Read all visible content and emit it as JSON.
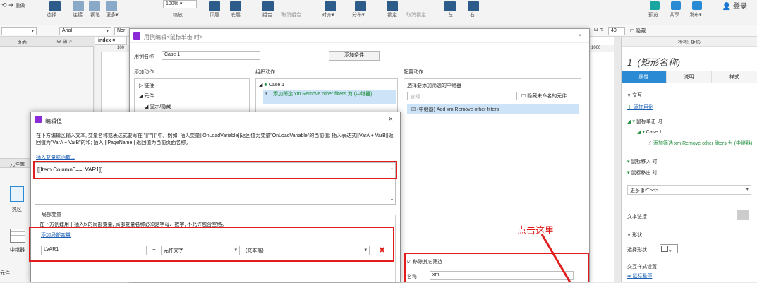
{
  "colors": {
    "accent": "#e11d1d",
    "purple": "#8b2bd8",
    "link": "#1a5fb4",
    "green": "#1e8c3a",
    "toolbar_blue": "#2d5b8a",
    "axure_blue": "#2a8bd4"
  },
  "toolbar": {
    "redo": "重做",
    "select": "选择",
    "connect": "连接",
    "pen": "钢笔",
    "more": "更多▾",
    "zoom_value": "100%",
    "zoom_label": "缩放",
    "top": "顶层",
    "bottom": "底层",
    "group": "组合",
    "ungroup": "取消组合",
    "align": "对齐▾",
    "distribute": "分布▾",
    "lock": "锁定",
    "unlock": "取消锁定",
    "left": "左",
    "right": "右",
    "preview": "预览",
    "share": "共享",
    "publish": "发布▾",
    "login": "登录"
  },
  "fontbar": {
    "font": "Arial",
    "style_hint": "Nor",
    "height_label": "h:",
    "height_value": "40",
    "hidden_label": "隐藏"
  },
  "left_panel": {
    "pages_title": "页面",
    "widgets_title": "元件库",
    "hotspot": "热区",
    "repeater": "中继器",
    "widget_footer": "元件"
  },
  "canvas": {
    "tab": "index",
    "ruler_100": "100",
    "ruler_1000": "1000"
  },
  "right_panel": {
    "title": "检视: 矩形",
    "shape_name": "(矩形名称)",
    "shape_index": "1",
    "tabs": [
      "属性",
      "说明",
      "样式"
    ],
    "interaction": "交互",
    "add_case": "添加用例",
    "on_click": "鼠标单击 时",
    "case1": "Case 1",
    "add_filter_action": "添加筛选 xm Remove other filters 为 (中继器)",
    "on_mouse_enter": "鼠标移入 时",
    "on_mouse_leave": "鼠标移出 时",
    "more_events": "更多事件>>>",
    "text_link": "文本链接",
    "shape_section": "形状",
    "select_shape": "选择形状",
    "interaction_style": "交互样式设置",
    "mouse_hover": "鼠标悬停"
  },
  "case_editor": {
    "title": "用例编辑<鼠标单击 时>",
    "case_name_label": "用例名称",
    "case_name_value": "Case 1",
    "add_condition": "添加条件",
    "add_action": "添加动作",
    "organize_actions": "组织动作",
    "configure_action": "配置动作",
    "tree_link": "链接",
    "tree_widget": "元件",
    "tree_showhide": "显示/隐藏",
    "org_case": "Case 1",
    "org_action": "添加筛选 xm Remove other filters 为 (中继器)",
    "select_repeater": "选择要添加筛选的中继器",
    "search_placeholder": "查找",
    "hide_unnamed": "隐藏未命名的元件",
    "repeater_item": "(中继器) Add xm Remove other filters",
    "remove_other_filters": "移除其它筛选",
    "name_label": "名称",
    "name_value": "xm"
  },
  "value_editor": {
    "title": "编辑值",
    "description": "在下方编辑区输入文本, 变量名称或表达式要写在 \"[[\"\"]]\" 中。例如: 插入变量[[OnLoadVariable]]返回值为变量\"OnLoadVariable\"的当前值; 插入表达式[[VarA + VarB]]返回值为\"VarA + VarB\"的和; 插入 [[PageName]] 返回值为当前页面名称。",
    "insert_var_link": "插入变量或函数...",
    "expression": "[[Item.Column0==LVAR1]]",
    "local_vars_title": "局部变量",
    "local_vars_desc": "在下方创建用于插入fx的局部变量, 局部变量名称必须是字母、数字, 不允许包含空格。",
    "add_local_var": "添加局部变量",
    "var_name": "LVAR1",
    "equals": "=",
    "var_type": "元件文字",
    "var_target": "(文本框)"
  },
  "annotation": {
    "click_here": "点击这里"
  }
}
